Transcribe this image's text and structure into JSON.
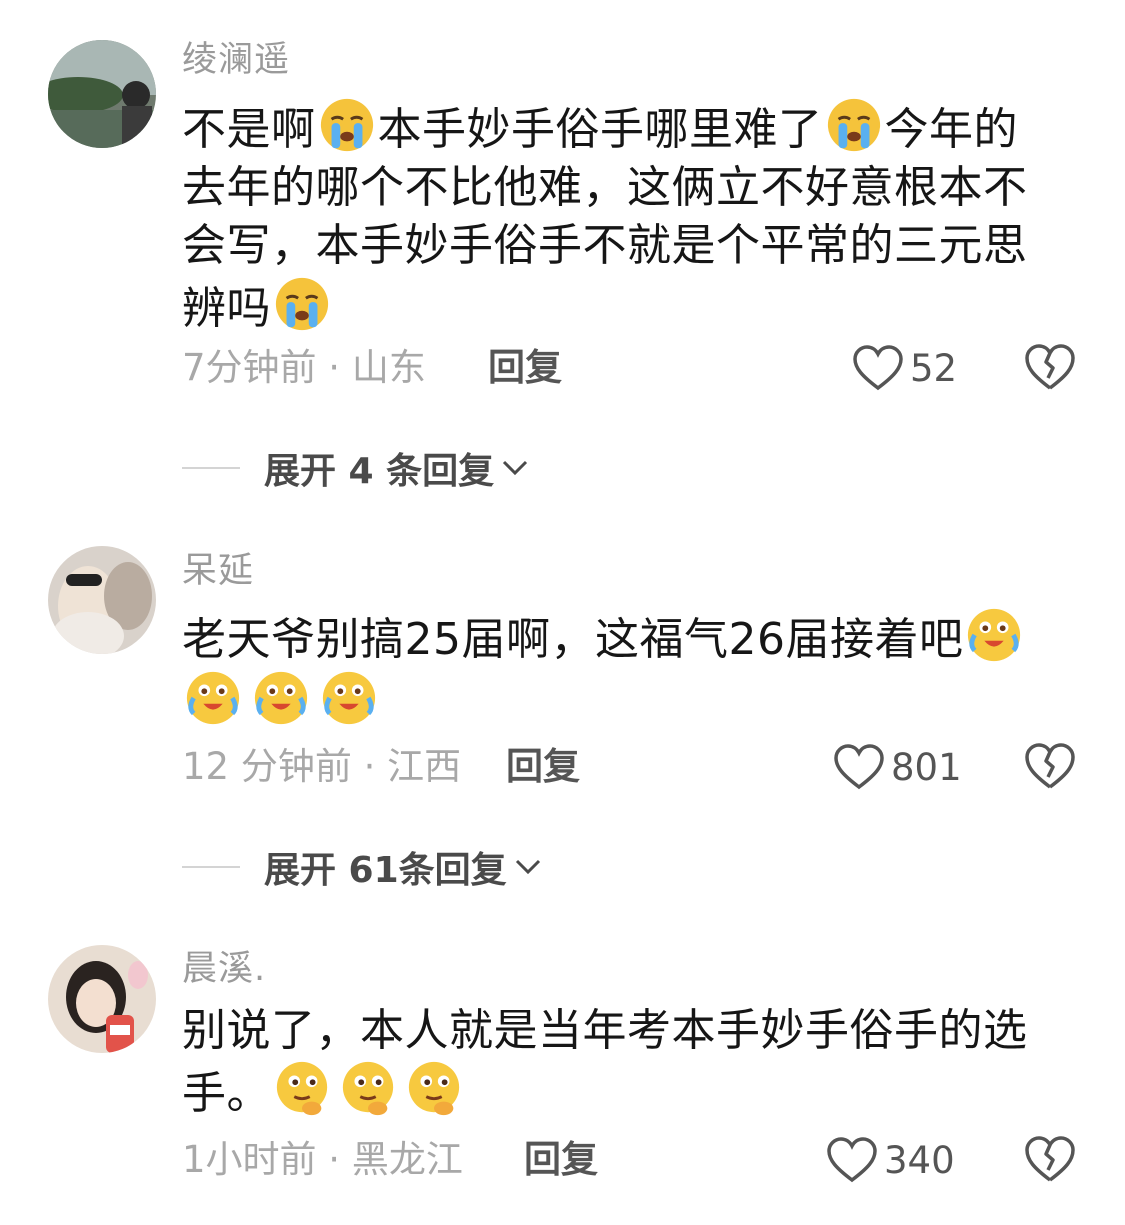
{
  "comments": [
    {
      "username": "绫澜遥",
      "text_parts": [
        "不是啊",
        "本手妙手俗手哪里难了",
        "今年的去年的哪个不比他难，这俩立不好意根本不会写，本手妙手俗手不就是个平常的三元思辨吗"
      ],
      "time_location": "7分钟前 · 山东",
      "reply_label": "回复",
      "likes": "52",
      "expand_label": "展开 4 条回复",
      "emoji": "loudly-crying-face"
    },
    {
      "username": "呆延",
      "text": "老天爷别搞25届啊，这福气26届接着吧",
      "time_location": "12 分钟前 · 江西",
      "reply_label": "回复",
      "likes": "801",
      "expand_label": "展开 61条回复",
      "emoji": "crying-laughing-face"
    },
    {
      "username": "晨溪.",
      "text_parts": [
        "别说了，本人就是当年考本手妙手俗手的选",
        "手。"
      ],
      "time_location": "1小时前 · 黑龙江",
      "reply_label": "回复",
      "likes": "340",
      "emoji": "thinking-face"
    }
  ],
  "colors": {
    "username": "#9a9a9a",
    "text": "#161616",
    "meta": "#a8a8a8",
    "action": "#555555"
  }
}
